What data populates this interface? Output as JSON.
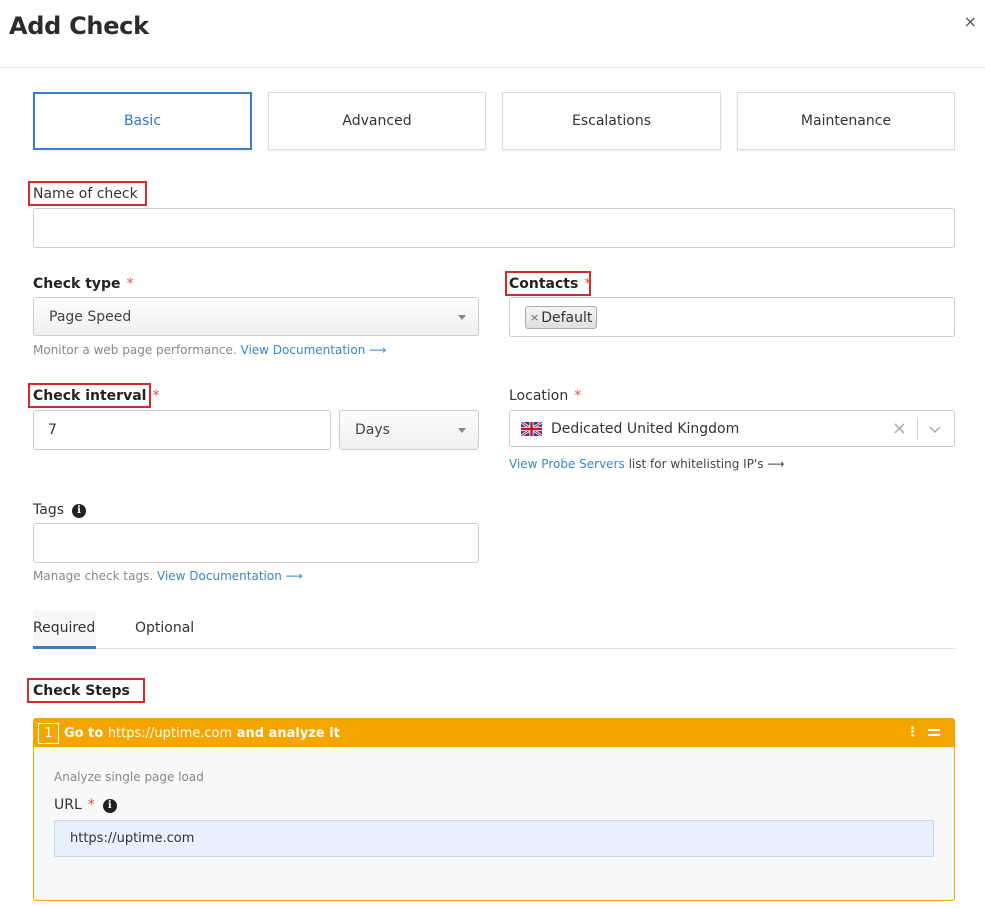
{
  "dialog": {
    "title": "Add Check",
    "close_label": "×"
  },
  "tabs": [
    {
      "label": "Basic",
      "active": true
    },
    {
      "label": "Advanced",
      "active": false
    },
    {
      "label": "Escalations",
      "active": false
    },
    {
      "label": "Maintenance",
      "active": false
    }
  ],
  "name_of_check": {
    "label": "Name of check",
    "value": ""
  },
  "check_type": {
    "label": "Check type",
    "required_mark": "*",
    "selected": "Page Speed",
    "help_text": "Monitor a web page performance.",
    "help_link": "View Documentation ⟶"
  },
  "contacts": {
    "label": "Contacts",
    "required_mark": "*",
    "chips": [
      {
        "remove": "×",
        "label": "Default"
      }
    ]
  },
  "check_interval": {
    "label": "Check interval",
    "required_mark": "*",
    "value": "7",
    "unit_selected": "Days"
  },
  "location": {
    "label": "Location",
    "required_mark": "*",
    "selected": "Dedicated United Kingdom",
    "clear_label": "×",
    "help_link": "View Probe Servers",
    "help_text": "list for whitelisting IP's ⟶"
  },
  "tags": {
    "label": "Tags",
    "info_glyph": "i",
    "value": "",
    "help_text": "Manage check tags.",
    "help_link": "View Documentation ⟶"
  },
  "subtabs": [
    {
      "label": "Required",
      "active": true
    },
    {
      "label": "Optional",
      "active": false
    }
  ],
  "check_steps": {
    "heading": "Check Steps",
    "steps": [
      {
        "number": "1",
        "title_prefix": "Go to",
        "title_url": "https://uptime.com",
        "title_suffix": "and analyze it",
        "kebab": "⋮",
        "description": "Analyze single page load",
        "url_label": "URL",
        "url_required_mark": "*",
        "url_info_glyph": "i",
        "url_value": "https://uptime.com"
      }
    ]
  },
  "colors": {
    "accent": "#3a7fc4",
    "link": "#3a87c8",
    "required": "#d9534f",
    "step_header": "#f5a500",
    "highlight_box": "#d42a2a"
  }
}
